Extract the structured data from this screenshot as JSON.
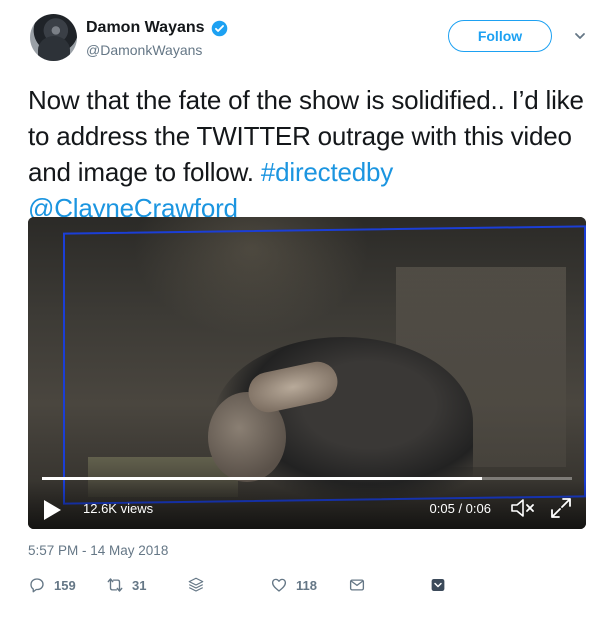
{
  "user": {
    "display_name": "Damon Wayans",
    "handle": "@DamonkWayans",
    "verified": true
  },
  "header": {
    "follow_label": "Follow"
  },
  "tweet": {
    "text_plain": "Now that the fate of the show is solidified.. I’d like to address the TWITTER outrage with this video and image to follow.  ",
    "hashtag": "#directedby",
    "mention": "@ClayneCrawford",
    "timestamp": "5:57 PM - 14 May 2018"
  },
  "video": {
    "views": "12.6K views",
    "time": "0:05 / 0:06",
    "progress": 0.83
  },
  "actions": {
    "replies": "159",
    "retweets": "31",
    "likes": "118"
  },
  "icons": {
    "verified": "verified-badge-icon",
    "caret": "chevron-down-icon",
    "play": "play-icon",
    "mute": "mute-icon",
    "expand": "expand-icon",
    "reply": "reply-icon",
    "retweet": "retweet-icon",
    "stack": "stack-icon",
    "like": "heart-icon",
    "dm": "mail-icon",
    "bookmark": "bookmark-icon"
  },
  "colors": {
    "accent": "#1da1f2",
    "link": "#1b95e0",
    "muted": "#657786",
    "text": "#14171a"
  }
}
